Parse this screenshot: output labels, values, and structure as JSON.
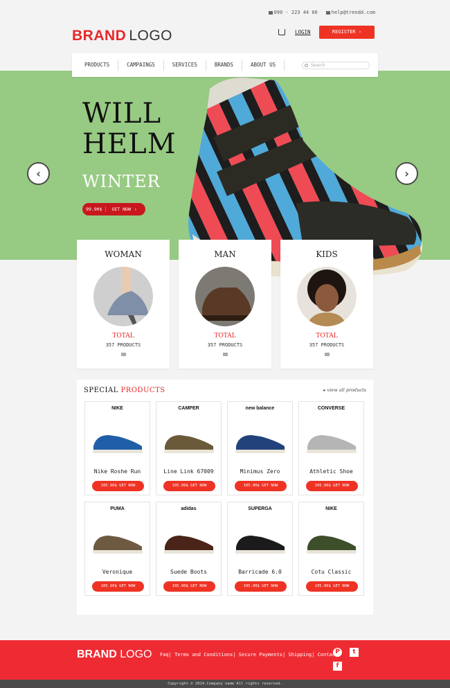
{
  "topbar": {
    "phone": "090 - 223 44 66",
    "email": "help@trendd.com"
  },
  "logo": {
    "part1": "BRAND",
    "part2": "LOGO"
  },
  "header": {
    "login": "LOGIN",
    "register": "REGISTER"
  },
  "nav": {
    "items": [
      "PRODUCTS",
      "CAMPAINGS",
      "SERVICES",
      "BRANDS",
      "ABOUT US"
    ],
    "search_placeholder": "Search"
  },
  "hero": {
    "title_line1": "WILL",
    "title_line2": "HELM",
    "subtitle": "WINTER",
    "price": "99.90$",
    "cta": "GET NOW"
  },
  "categories": [
    {
      "title": "WOMAN",
      "total": "TOTAL",
      "count": "357 PRODUCTS"
    },
    {
      "title": "MAN",
      "total": "TOTAL",
      "count": "357 PRODUCTS"
    },
    {
      "title": "KIDS",
      "total": "TOTAL",
      "count": "357 PRODUCTS"
    }
  ],
  "special": {
    "heading_black": "SPECIAL",
    "heading_red": "PRODUCTS",
    "view_all": "view all products",
    "products": [
      {
        "brand": "NIKE",
        "name": "Nike Roshe Run",
        "btn": "105.90$ GET NOW",
        "color": "#1f5fa8"
      },
      {
        "brand": "CAMPER",
        "name": "Line Link 67009",
        "btn": "105.90$ GET NOW",
        "color": "#6b5a3a"
      },
      {
        "brand": "new balance",
        "name": "Minimus Zero",
        "btn": "105.90$ GET NOW",
        "color": "#21427a"
      },
      {
        "brand": "CONVERSE",
        "name": "Athletic Shoe",
        "btn": "105.90$ GET NOW",
        "color": "#b5b5b5"
      },
      {
        "brand": "PUMA",
        "name": "Veronique",
        "btn": "105.90$ GET NOW",
        "color": "#6e5a40"
      },
      {
        "brand": "adidas",
        "name": "Suede Boots",
        "btn": "105.90$ GET NOW",
        "color": "#4a2418"
      },
      {
        "brand": "SUPERGA",
        "name": "Barricade 6.0",
        "btn": "105.90$ GET NOW",
        "color": "#1b1b1b"
      },
      {
        "brand": "NIKE",
        "name": "Cotu Classic",
        "btn": "105.90$ GET NOW",
        "color": "#3d4e2a"
      }
    ]
  },
  "footer": {
    "links": "Faq| Terms and Conditions| Secure Payments| Shipping| Contact",
    "copyright": "Copyright © 2014.Company name All rights reserved."
  },
  "colors": {
    "accent": "#ee3325",
    "hero_bg": "#97ca83",
    "footer_bg": "#ee2b33"
  }
}
